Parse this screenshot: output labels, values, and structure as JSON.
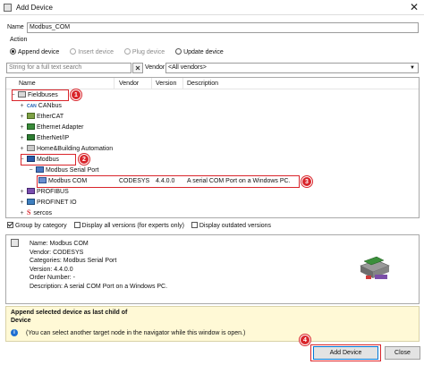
{
  "window": {
    "title": "Add Device",
    "close_glyph": "✕"
  },
  "name_field": {
    "label": "Name",
    "value": "Modbus_COM"
  },
  "action": {
    "label": "Action",
    "options": [
      {
        "label": "Append device",
        "selected": true,
        "enabled": true
      },
      {
        "label": "Insert device",
        "selected": false,
        "enabled": false
      },
      {
        "label": "Plug device",
        "selected": false,
        "enabled": false
      },
      {
        "label": "Update device",
        "selected": false,
        "enabled": true
      }
    ]
  },
  "search": {
    "placeholder": "String for a full text search"
  },
  "vendor": {
    "label": "Vendor",
    "selected": "<All vendors>"
  },
  "columns": {
    "name": "Name",
    "vendor": "Vendor",
    "version": "Version",
    "description": "Description"
  },
  "tree": [
    {
      "label": "Fieldbuses",
      "expander": "−",
      "icon": "fieldbus-icon"
    },
    {
      "label": "CANbus",
      "expander": "+",
      "icon": "canbus-icon",
      "icon_text": "CAN"
    },
    {
      "label": "EtherCAT",
      "expander": "+",
      "icon": "ethercat-icon"
    },
    {
      "label": "Ethernet Adapter",
      "expander": "+",
      "icon": "ethernet-icon"
    },
    {
      "label": "EtherNet/IP",
      "expander": "+",
      "icon": "ethernetip-icon"
    },
    {
      "label": "Home&Building Automation",
      "expander": "+",
      "icon": "home-building-icon"
    },
    {
      "label": "Modbus",
      "expander": "−",
      "icon": "modbus-icon"
    },
    {
      "label": "Modbus Serial Port",
      "expander": "−",
      "icon": "serial-port-icon"
    },
    {
      "label": "Modbus COM",
      "expander": "",
      "icon": "com-device-icon",
      "vendor": "CODESYS",
      "version": "4.4.0.0",
      "description": "A serial COM Port on a Windows PC."
    },
    {
      "label": "PROFIBUS",
      "expander": "+",
      "icon": "profibus-icon"
    },
    {
      "label": "PROFINET IO",
      "expander": "+",
      "icon": "profinet-icon"
    },
    {
      "label": "sercos",
      "expander": "+",
      "icon": "sercos-icon",
      "icon_text": "S"
    }
  ],
  "options": [
    {
      "label": "Group by category",
      "checked": true
    },
    {
      "label": "Display all versions (for experts only)",
      "checked": false
    },
    {
      "label": "Display outdated versions",
      "checked": false
    }
  ],
  "details": {
    "name": "Name: Modbus COM",
    "vendor": "Vendor: CODESYS",
    "categories": "Categories: Modbus Serial Port",
    "version": "Version: 4.4.0.0",
    "order_number": "Order Number: -",
    "description": "Description: A serial COM Port on a Windows PC."
  },
  "info": {
    "line1": "Append selected device as last child of",
    "line2": "Device",
    "note": "(You can select another target node in the navigator while this window is open.)",
    "info_icon": "i"
  },
  "buttons": {
    "add": "Add Device",
    "close": "Close"
  },
  "annotations": [
    "1",
    "2",
    "3",
    "4"
  ],
  "colors": {
    "highlight": "#d9252b",
    "info_bg": "#fff9d6",
    "selection": "#cde8ff"
  }
}
